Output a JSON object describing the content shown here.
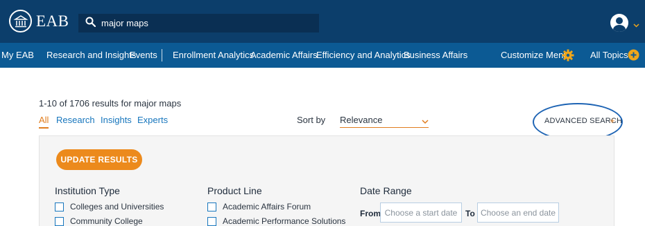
{
  "header": {
    "logo_text": "EAB",
    "search_value": "major maps",
    "search_placeholder": "Search",
    "brand_color": "#0c3e6b"
  },
  "nav": {
    "items": [
      "My EAB",
      "Research and Insights",
      "Events",
      "Enrollment Analytics",
      "Academic Affairs",
      "Efficiency and Analytics",
      "Business Affairs"
    ],
    "customize_label": "Customize Menu",
    "all_topics_label": "All Topics",
    "accent_color": "#f0a61a"
  },
  "results": {
    "count_text": "1-10 of 1706 results for major maps",
    "tabs": [
      "All",
      "Research",
      "Insights",
      "Experts"
    ],
    "active_tab": "All",
    "sort_label": "Sort by",
    "sort_value": "Relevance",
    "advanced_search_label": "ADVANCED SEARCH",
    "advanced_search_plus": "+"
  },
  "filters": {
    "update_button_label": "UPDATE RESULTS",
    "institution_type": {
      "title": "Institution Type",
      "options": [
        "Colleges and Universities",
        "Community College"
      ]
    },
    "product_line": {
      "title": "Product Line",
      "options": [
        "Academic Affairs Forum",
        "Academic Performance Solutions"
      ]
    },
    "date_range": {
      "title": "Date Range",
      "from_label": "From",
      "to_label": "To",
      "start_placeholder": "Choose a start date",
      "end_placeholder": "Choose an end date"
    }
  }
}
